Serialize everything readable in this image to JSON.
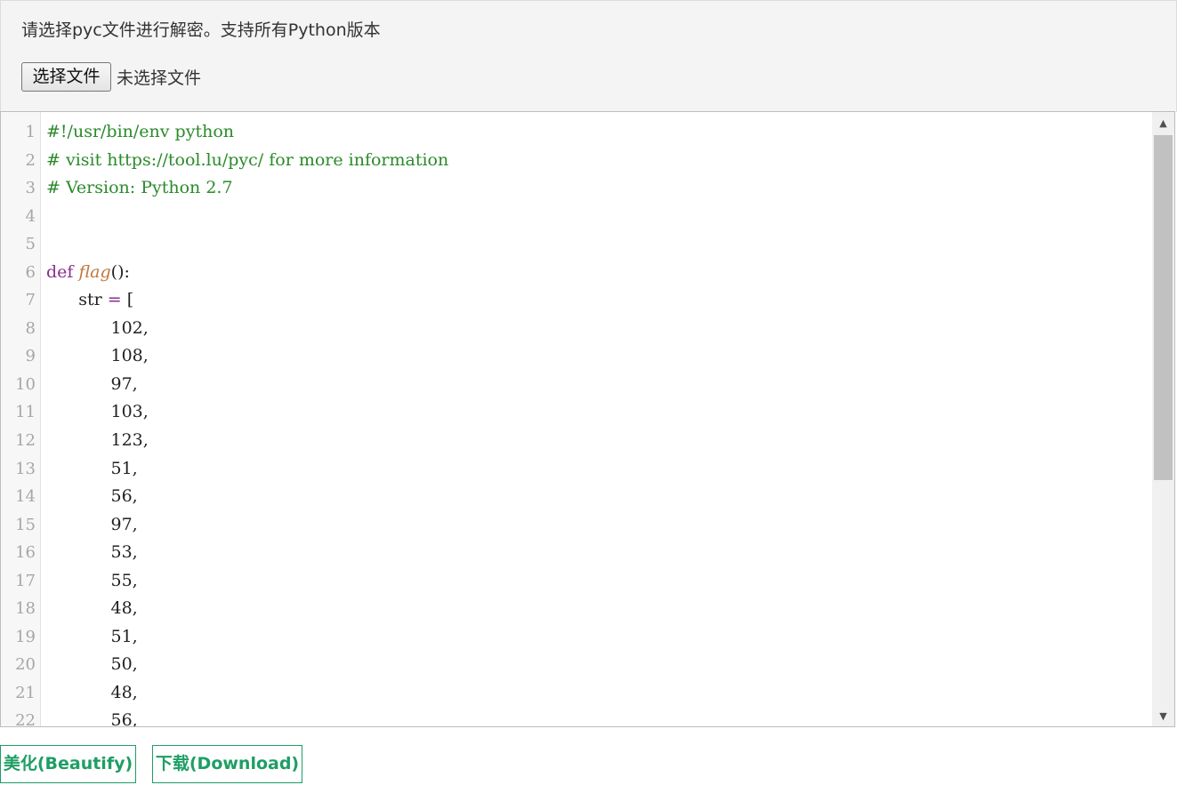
{
  "upload": {
    "hint": "请选择pyc文件进行解密。支持所有Python版本",
    "choose_button": "选择文件",
    "file_status": "未选择文件"
  },
  "editor": {
    "lines": [
      {
        "n": "1",
        "tokens": [
          {
            "t": "#!/usr/bin/env python",
            "c": "comment"
          }
        ]
      },
      {
        "n": "2",
        "tokens": [
          {
            "t": "# visit https://tool.lu/pyc/ for more information",
            "c": "comment"
          }
        ]
      },
      {
        "n": "3",
        "tokens": [
          {
            "t": "# Version: Python 2.7",
            "c": "comment"
          }
        ]
      },
      {
        "n": "4",
        "tokens": []
      },
      {
        "n": "5",
        "tokens": []
      },
      {
        "n": "6",
        "tokens": [
          {
            "t": "def",
            "c": "kw"
          },
          {
            "t": " ",
            "c": ""
          },
          {
            "t": "flag",
            "c": "def-name"
          },
          {
            "t": "():",
            "c": ""
          }
        ]
      },
      {
        "n": "7",
        "tokens": [
          {
            "t": "      str ",
            "c": ""
          },
          {
            "t": "=",
            "c": "op"
          },
          {
            "t": " [",
            "c": ""
          }
        ]
      },
      {
        "n": "8",
        "tokens": [
          {
            "t": "            102,",
            "c": ""
          }
        ]
      },
      {
        "n": "9",
        "tokens": [
          {
            "t": "            108,",
            "c": ""
          }
        ]
      },
      {
        "n": "10",
        "tokens": [
          {
            "t": "            97,",
            "c": ""
          }
        ]
      },
      {
        "n": "11",
        "tokens": [
          {
            "t": "            103,",
            "c": ""
          }
        ]
      },
      {
        "n": "12",
        "tokens": [
          {
            "t": "            123,",
            "c": ""
          }
        ]
      },
      {
        "n": "13",
        "tokens": [
          {
            "t": "            51,",
            "c": ""
          }
        ]
      },
      {
        "n": "14",
        "tokens": [
          {
            "t": "            56,",
            "c": ""
          }
        ]
      },
      {
        "n": "15",
        "tokens": [
          {
            "t": "            97,",
            "c": ""
          }
        ]
      },
      {
        "n": "16",
        "tokens": [
          {
            "t": "            53,",
            "c": ""
          }
        ]
      },
      {
        "n": "17",
        "tokens": [
          {
            "t": "            55,",
            "c": ""
          }
        ]
      },
      {
        "n": "18",
        "tokens": [
          {
            "t": "            48,",
            "c": ""
          }
        ]
      },
      {
        "n": "19",
        "tokens": [
          {
            "t": "            51,",
            "c": ""
          }
        ]
      },
      {
        "n": "20",
        "tokens": [
          {
            "t": "            50,",
            "c": ""
          }
        ]
      },
      {
        "n": "21",
        "tokens": [
          {
            "t": "            48,",
            "c": ""
          }
        ]
      },
      {
        "n": "22",
        "tokens": [
          {
            "t": "            56,",
            "c": ""
          }
        ]
      }
    ],
    "scroll_up_icon": "▲",
    "scroll_down_icon": "▼"
  },
  "actions": {
    "beautify_label": "美化(Beautify)",
    "download_label": "下载(Download)"
  }
}
